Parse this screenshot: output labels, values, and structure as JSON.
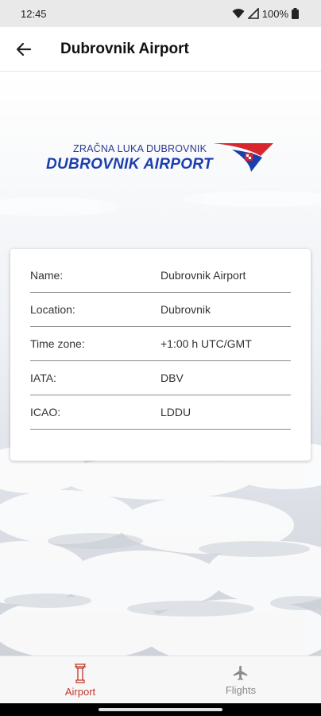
{
  "status_bar": {
    "time": "12:45",
    "battery": "100%"
  },
  "app_bar": {
    "title": "Dubrovnik Airport",
    "back_icon": "arrow-left-icon"
  },
  "logo": {
    "top_text": "ZRAČNA LUKA DUBROVNIK",
    "main_text": "DUBROVNIK AIRPORT",
    "colors": {
      "blue": "#1b3fae",
      "red": "#d8262e"
    }
  },
  "info": {
    "rows": [
      {
        "label": "Name:",
        "value": "Dubrovnik Airport"
      },
      {
        "label": "Location:",
        "value": "Dubrovnik"
      },
      {
        "label": "Time zone:",
        "value": "+1:00 h UTC/GMT"
      },
      {
        "label": "IATA:",
        "value": "DBV"
      },
      {
        "label": "ICAO:",
        "value": "LDDU"
      }
    ]
  },
  "bottom_nav": {
    "items": [
      {
        "label": "Airport",
        "icon": "control-tower-icon",
        "active": true
      },
      {
        "label": "Flights",
        "icon": "airplane-icon",
        "active": false
      }
    ],
    "active_color": "#c0392b",
    "inactive_color": "#8a8a8a"
  }
}
